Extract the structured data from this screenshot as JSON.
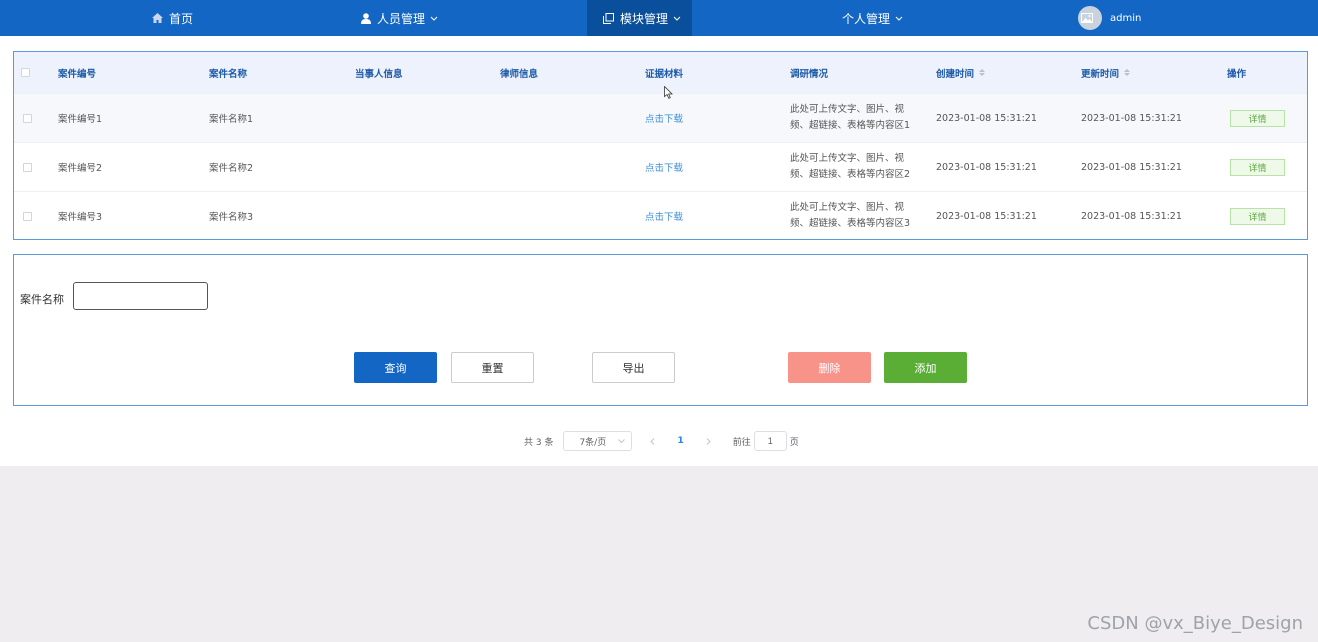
{
  "nav": {
    "home": "首页",
    "personnel": "人员管理",
    "modules": "模块管理",
    "personal": "个人管理",
    "user": "admin"
  },
  "table": {
    "headers": {
      "case_no": "案件编号",
      "case_name": "案件名称",
      "party_info": "当事人信息",
      "lawyer_info": "律师信息",
      "evidence": "证据材料",
      "research": "调研情况",
      "created": "创建时间",
      "updated": "更新时间",
      "action": "操作"
    },
    "rows": [
      {
        "case_no": "案件编号1",
        "case_name": "案件名称1",
        "evidence": "点击下载",
        "research_line1": "此处可上传文字、图片、视",
        "research_line2": "频、超链接、表格等内容区1",
        "created": "2023-01-08 15:31:21",
        "updated": "2023-01-08 15:31:21",
        "action": "详情"
      },
      {
        "case_no": "案件编号2",
        "case_name": "案件名称2",
        "evidence": "点击下载",
        "research_line1": "此处可上传文字、图片、视",
        "research_line2": "频、超链接、表格等内容区2",
        "created": "2023-01-08 15:31:21",
        "updated": "2023-01-08 15:31:21",
        "action": "详情"
      },
      {
        "case_no": "案件编号3",
        "case_name": "案件名称3",
        "evidence": "点击下载",
        "research_line1": "此处可上传文字、图片、视",
        "research_line2": "频、超链接、表格等内容区3",
        "created": "2023-01-08 15:31:21",
        "updated": "2023-01-08 15:31:21",
        "action": "详情"
      }
    ]
  },
  "search": {
    "label": "案件名称",
    "value": "",
    "buttons": {
      "query": "查询",
      "reset": "重置",
      "export": "导出",
      "delete": "删除",
      "add": "添加"
    }
  },
  "pagination": {
    "total": "共 3 条",
    "page_size": "7条/页",
    "current_page": "1",
    "goto_prefix": "前往",
    "goto_value": "1",
    "goto_suffix": "页"
  },
  "watermark": "CSDN @vx_Biye_Design"
}
